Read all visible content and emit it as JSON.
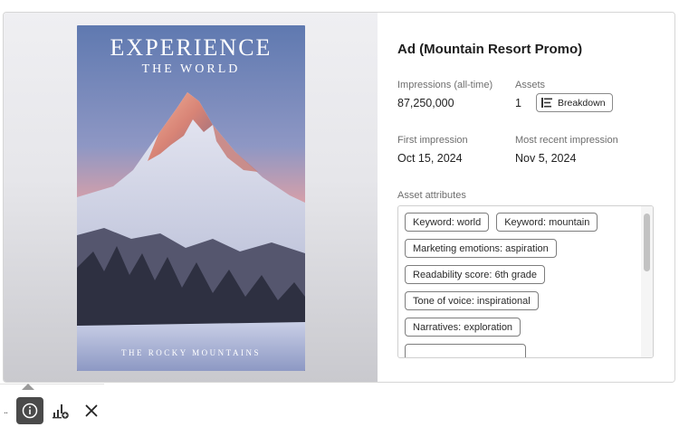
{
  "poster": {
    "title": "EXPERIENCE",
    "subtitle": "THE WORLD",
    "caption": "THE ROCKY MOUNTAINS"
  },
  "details": {
    "ad_title": "Ad (Mountain Resort Promo)",
    "impressions_label": "Impressions (all-time)",
    "impressions_value": "87,250,000",
    "assets_label": "Assets",
    "assets_value": "1",
    "breakdown_label": "Breakdown",
    "first_impression_label": "First impression",
    "first_impression_value": "Oct 15, 2024",
    "recent_impression_label": "Most recent impression",
    "recent_impression_value": "Nov 5, 2024",
    "attributes_label": "Asset attributes",
    "attributes": [
      "Keyword: world",
      "Keyword: mountain",
      "Marketing emotions: aspiration",
      "Readability score: 6th grade",
      "Tone of voice: inspirational",
      "Narratives: exploration"
    ]
  },
  "toolbar": {
    "more_label": "..",
    "items": [
      "info-icon",
      "chart-add-icon",
      "close-icon"
    ]
  },
  "colors": {
    "toolbar_active": "#4a4a4a",
    "sky_top": "#6f86b8",
    "sky_glow": "#e8a08a",
    "snow": "#dfe3ef"
  }
}
